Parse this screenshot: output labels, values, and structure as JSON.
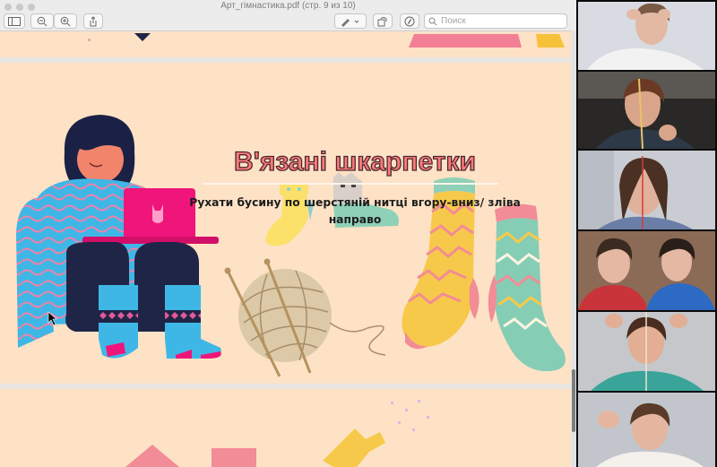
{
  "toolbar": {
    "title": "Арт_гімнастика.pdf (стр. 9 из 10)",
    "search_placeholder": "Поиск",
    "icons": [
      "sidebar-icon",
      "zoom-out-icon",
      "zoom-in-icon",
      "share-icon",
      "pen-icon",
      "rotate-icon",
      "markup-icon",
      "search-icon"
    ]
  },
  "slide": {
    "title": "В'язані шкарпетки",
    "subtitle": "Рухати бусину по шерстяній нитці вгору-вниз/ зліва направо"
  },
  "colors": {
    "page_bg": "#fde2c6",
    "title_fill": "#ff7a7a",
    "pink": "#f0157a",
    "blue": "#3fb7e6",
    "navy": "#1f2547",
    "yellow": "#f7c94a",
    "mint": "#86cdb6"
  },
  "video": {
    "participants": [
      {
        "name": "participant-1"
      },
      {
        "name": "participant-2"
      },
      {
        "name": "participant-3"
      },
      {
        "name": "participant-4"
      },
      {
        "name": "participant-5"
      },
      {
        "name": "participant-6"
      }
    ]
  }
}
